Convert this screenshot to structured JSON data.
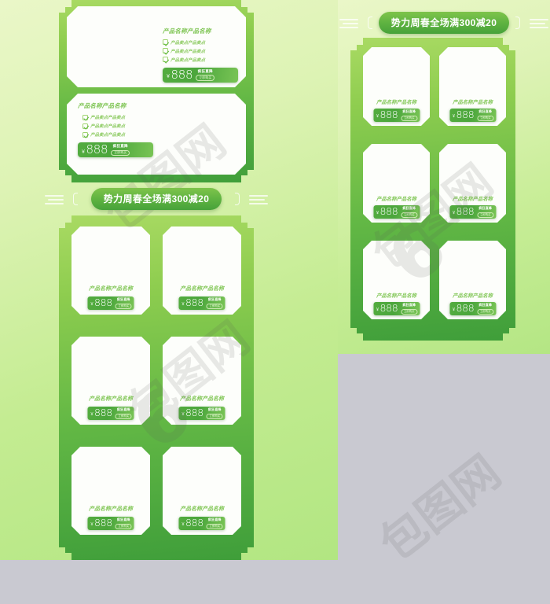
{
  "page": {
    "background_color": "#c9c9d1",
    "panel_green_top": "#a9da63",
    "panel_green_bottom": "#3f9e3a",
    "page_green_top": "#eaf7c8",
    "page_green_bottom": "#b2e682",
    "accent_color": "#62b83f"
  },
  "watermark": {
    "text": "包图网",
    "mark": "6"
  },
  "common": {
    "product_title": "产品名称产品名称",
    "sell_point": "产品卖点产品卖点",
    "currency": "￥",
    "price": "888",
    "price_label": "疯狂直降",
    "buy_button": "立即购买",
    "check_icon": "check-icon"
  },
  "left_column": {
    "hero_cards": [
      {
        "title": "产品名称产品名称",
        "sell_points": [
          "产品卖点产品卖点",
          "产品卖点产品卖点",
          "产品卖点产品卖点"
        ],
        "currency": "￥",
        "price": "888",
        "price_label": "疯狂直降",
        "buy_button": "立即购买"
      },
      {
        "title": "产品名称产品名称",
        "sell_points": [
          "产品卖点产品卖点",
          "产品卖点产品卖点",
          "产品卖点产品卖点"
        ],
        "currency": "￥",
        "price": "888",
        "price_label": "疯狂直降",
        "buy_button": "立即购买"
      }
    ],
    "banner": {
      "text": "势力周春全场满300减20"
    },
    "grid_cards": [
      {
        "title": "产品名称产品名称",
        "currency": "￥",
        "price": "888",
        "price_label": "疯狂直降",
        "buy_button": "立即购买"
      },
      {
        "title": "产品名称产品名称",
        "currency": "￥",
        "price": "888",
        "price_label": "疯狂直降",
        "buy_button": "立即购买"
      },
      {
        "title": "产品名称产品名称",
        "currency": "￥",
        "price": "888",
        "price_label": "疯狂直降",
        "buy_button": "立即购买"
      },
      {
        "title": "产品名称产品名称",
        "currency": "￥",
        "price": "888",
        "price_label": "疯狂直降",
        "buy_button": "立即购买"
      },
      {
        "title": "产品名称产品名称",
        "currency": "￥",
        "price": "888",
        "price_label": "疯狂直降",
        "buy_button": "立即购买"
      },
      {
        "title": "产品名称产品名称",
        "currency": "￥",
        "price": "888",
        "price_label": "疯狂直降",
        "buy_button": "立即购买"
      }
    ]
  },
  "right_column": {
    "banner": {
      "text": "势力周春全场满300减20"
    },
    "grid_cards": [
      {
        "title": "产品名称产品名称",
        "currency": "￥",
        "price": "888",
        "price_label": "疯狂直降",
        "buy_button": "立即购买"
      },
      {
        "title": "产品名称产品名称",
        "currency": "￥",
        "price": "888",
        "price_label": "疯狂直降",
        "buy_button": "立即购买"
      },
      {
        "title": "产品名称产品名称",
        "currency": "￥",
        "price": "888",
        "price_label": "疯狂直降",
        "buy_button": "立即购买"
      },
      {
        "title": "产品名称产品名称",
        "currency": "￥",
        "price": "888",
        "price_label": "疯狂直降",
        "buy_button": "立即购买"
      },
      {
        "title": "产品名称产品名称",
        "currency": "￥",
        "price": "888",
        "price_label": "疯狂直降",
        "buy_button": "立即购买"
      },
      {
        "title": "产品名称产品名称",
        "currency": "￥",
        "price": "888",
        "price_label": "疯狂直降",
        "buy_button": "立即购买"
      }
    ]
  }
}
